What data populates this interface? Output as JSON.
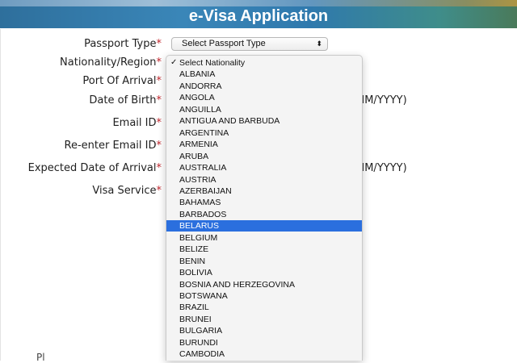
{
  "header": {
    "title": "e-Visa Application"
  },
  "form": {
    "labels": [
      {
        "key": "passport_type",
        "text": "Passport Type"
      },
      {
        "key": "nationality",
        "text": "Nationality/Region"
      },
      {
        "key": "port",
        "text": "Port Of Arrival"
      },
      {
        "key": "dob",
        "text": "Date of Birth"
      },
      {
        "key": "email",
        "text": "Email ID"
      },
      {
        "key": "email2",
        "text": "Re-enter Email ID"
      },
      {
        "key": "arrival",
        "text": "Expected Date of Arrival"
      },
      {
        "key": "visa_service",
        "text": "Visa Service"
      }
    ],
    "required_mark": "*",
    "passport_type_select": {
      "value": "Select Passport Type",
      "arrow": "⬍"
    },
    "dob_format": "MM/YYYY)",
    "arrival_format": "MM/YYYY)",
    "bottom_cut_text": "Pl"
  },
  "nationality_dropdown": {
    "checked_mark": "✓",
    "selected_index": 14,
    "options": [
      "Select Nationality",
      "ALBANIA",
      "ANDORRA",
      "ANGOLA",
      "ANGUILLA",
      "ANTIGUA AND BARBUDA",
      "ARGENTINA",
      "ARMENIA",
      "ARUBA",
      "AUSTRALIA",
      "AUSTRIA",
      "AZERBAIJAN",
      "BAHAMAS",
      "BARBADOS",
      "BELARUS",
      "BELGIUM",
      "BELIZE",
      "BENIN",
      "BOLIVIA",
      "BOSNIA AND HERZEGOVINA",
      "BOTSWANA",
      "BRAZIL",
      "BRUNEI",
      "BULGARIA",
      "BURUNDI",
      "CAMBODIA"
    ]
  },
  "colors": {
    "banner": "#2e6f9c",
    "required": "#c0262d",
    "selected_option": "#2b6fde"
  }
}
